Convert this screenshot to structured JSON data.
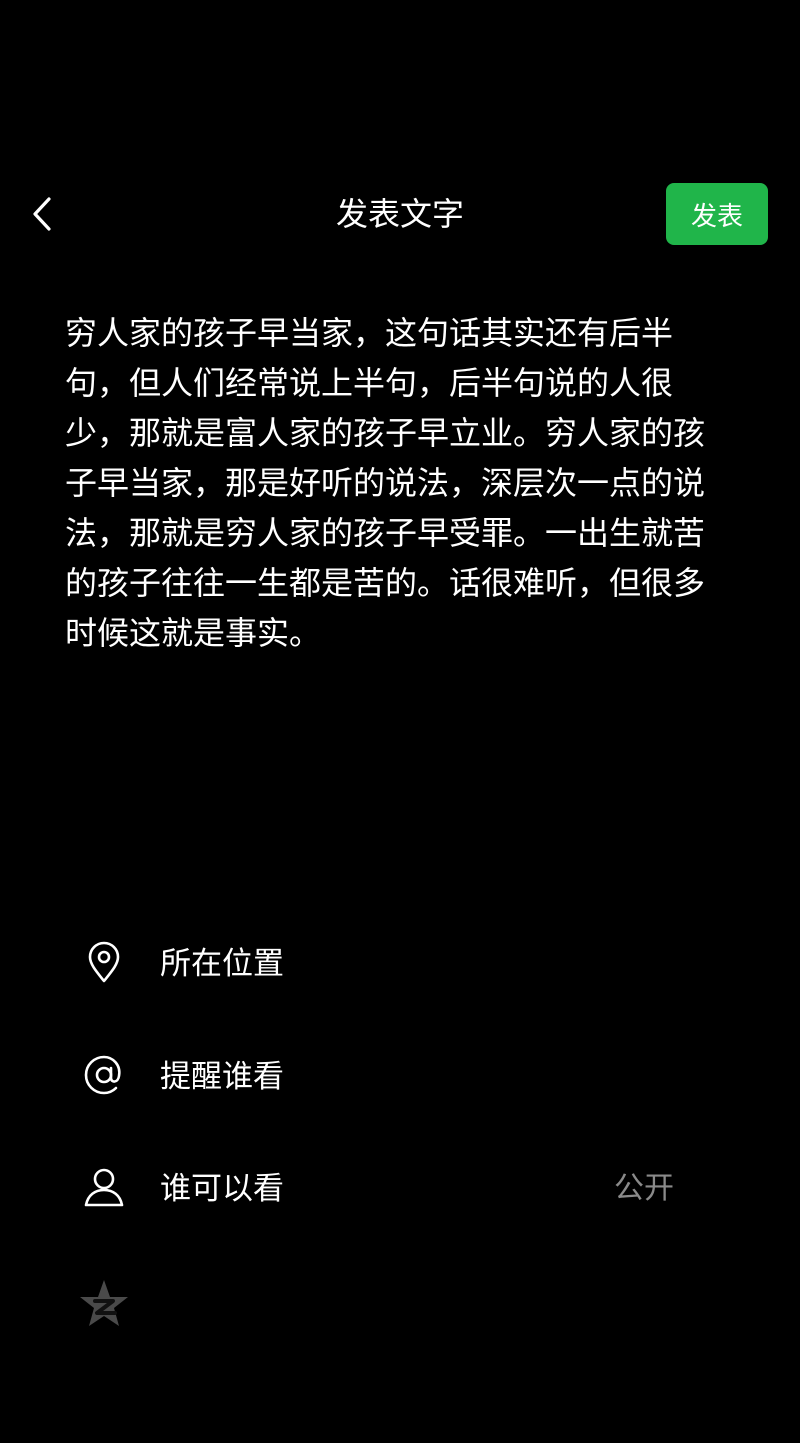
{
  "header": {
    "back_icon": "chevron-left-icon",
    "title": "发表文字",
    "publish_label": "发表",
    "publish_color": "#20b54a"
  },
  "post": {
    "text": "穷人家的孩子早当家，这句话其实还有后半句，但人们经常说上半句，后半句说的人很少，那就是富人家的孩子早立业。穷人家的孩子早当家，那是好听的说法，深层次一点的说法，那就是穷人家的孩子早受罪。一出生就苦的孩子往往一生都是苦的。话很难听，但很多时候这就是事实。"
  },
  "options": [
    {
      "icon": "location-pin-icon",
      "label": "所在位置",
      "value": ""
    },
    {
      "icon": "at-sign-icon",
      "label": "提醒谁看",
      "value": ""
    },
    {
      "icon": "person-icon",
      "label": "谁可以看",
      "value": "公开"
    }
  ],
  "share": {
    "icon": "qzone-star-icon"
  },
  "colors": {
    "background": "#000000",
    "text": "#ffffff",
    "muted": "#8a8a8a",
    "accent": "#20b54a"
  }
}
